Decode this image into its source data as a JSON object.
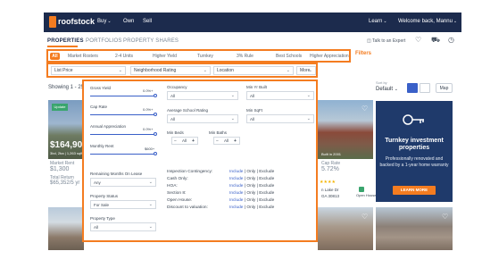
{
  "nav": {
    "brand": "roofstock",
    "items": [
      "Buy",
      "Own",
      "Sell"
    ],
    "learn": "Learn",
    "welcome": "Welcome back, Mannu"
  },
  "subnav": {
    "tabs": [
      "PROPERTIES",
      "PORTFOLIOS",
      "PROPERTY SHARES"
    ],
    "talk": "Talk to an Expert"
  },
  "categories": [
    "All",
    "Market Rosters",
    "2-4 Units",
    "Higher Yield",
    "Turnkey",
    "3% Rule",
    "Best Schools",
    "Higher Appreciation"
  ],
  "filters_label": "Filters",
  "dropdowns": [
    "List Price",
    "Neighborhood Rating",
    "Location",
    "More"
  ],
  "showing": "Showing 1 - 25",
  "sort": {
    "label": "Sort by",
    "value": "Default"
  },
  "map_button": "Map",
  "cards": [
    {
      "badge": "Update",
      "price": "$164,900",
      "subtitle": "3bd, 2ba | 1,263 sqft",
      "rent_label": "Market Rent",
      "rent": "$1,300",
      "return_label": "Total Return",
      "return_value": "$65,352/5 yr"
    },
    {
      "cap_label": "Cap Rate",
      "cap": "5.72%",
      "subtitle": "Built in 2001",
      "location": "n Lake Dr",
      "zip": "GA 30813",
      "open_house": "Open House"
    }
  ],
  "panel": {
    "gross_yield": {
      "label": "Gross Yield",
      "value": "0.0%+",
      "fraction": 0.0
    },
    "cap_rate": {
      "label": "Cap Rate",
      "value": "0.0%+",
      "fraction": 0.0
    },
    "annual_appreciation": {
      "label": "Annual Appreciation",
      "value": "0.0%+",
      "fraction": 0.0
    },
    "monthly_rent": {
      "label": "Monthly Rent",
      "value": "$600+",
      "fraction": 0.0
    },
    "occupancy": {
      "label": "Occupancy",
      "value": "All"
    },
    "year_built": {
      "label": "Min Yr Built",
      "value": "All"
    },
    "school_rating": {
      "label": "Average School Rating",
      "value": "All"
    },
    "min_sqft": {
      "label": "Min SqFt",
      "value": "All"
    },
    "min_beds": {
      "label": "Min Beds",
      "value": "All"
    },
    "min_baths": {
      "label": "Min Baths",
      "value": "All"
    },
    "remaining_months": {
      "label": "Remaining Months On Lease",
      "value": "Any"
    },
    "property_status": {
      "label": "Property Status",
      "value": "For Sale"
    },
    "property_type": {
      "label": "Property Type",
      "value": "All"
    },
    "toggles": [
      {
        "label": "Inspection Contingency:",
        "include": "Include",
        "only": "Only",
        "exclude": "Exclude"
      },
      {
        "label": "Cash Only:",
        "include": "Include",
        "only": "Only",
        "exclude": "Exclude"
      },
      {
        "label": "HOA:",
        "include": "Include",
        "only": "Only",
        "exclude": "Exclude"
      },
      {
        "label": "Section 8:",
        "include": "Include",
        "only": "Only",
        "exclude": "Exclude"
      },
      {
        "label": "Open House:",
        "include": "Include",
        "only": "Only",
        "exclude": "Exclude"
      },
      {
        "label": "Discount to valuation:",
        "include": "Include",
        "only": "Only",
        "exclude": "Exclude"
      }
    ]
  },
  "ad": {
    "title": "Turnkey investment properties",
    "body": "Professionally renovated and backed by a 1-year home warranty",
    "button": "LEARN MORE"
  },
  "icons": {
    "chevron": "chevron-down-icon",
    "heart": "heart-icon",
    "cart": "cart-icon",
    "clock": "clock-icon",
    "chat": "chat-icon",
    "key": "key-icon"
  },
  "colors": {
    "accent": "#f47c20",
    "navy": "#1c2b4d",
    "link": "#3a60c8"
  }
}
